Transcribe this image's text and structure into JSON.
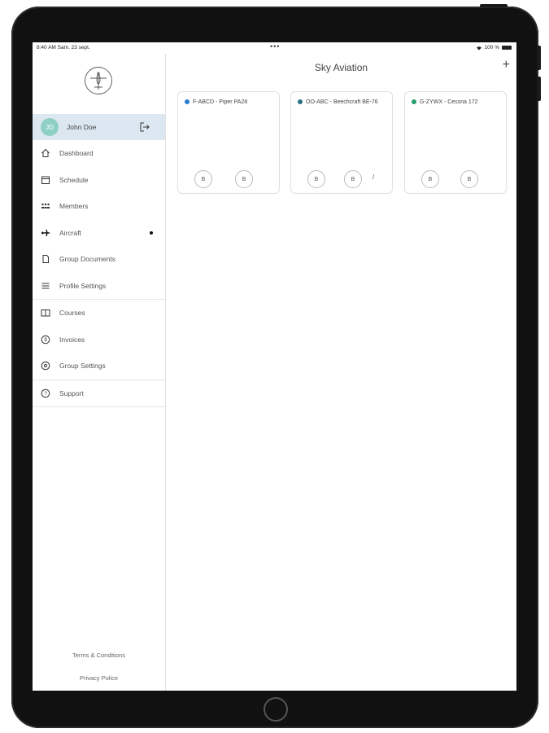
{
  "status_bar": {
    "time": "8:40 AM   Sam. 23 sept.",
    "dots": "•••",
    "battery": "100 %"
  },
  "app": {
    "title": "Sky Aviation",
    "add_label": "+"
  },
  "user": {
    "initials": "JD",
    "name": "John Doe"
  },
  "sidebar": {
    "items": [
      {
        "label": "Dashboard",
        "icon": "home-icon"
      },
      {
        "label": "Schedule",
        "icon": "calendar-icon"
      },
      {
        "label": "Members",
        "icon": "people-icon"
      },
      {
        "label": "Aircraft",
        "icon": "airplane-icon",
        "active_dot": true
      },
      {
        "label": "Group Documents",
        "icon": "document-icon"
      },
      {
        "label": "Profile Settings",
        "icon": "menu-lines-icon"
      },
      {
        "label": "Courses",
        "icon": "book-icon"
      },
      {
        "label": "Invoices",
        "icon": "dollar-icon"
      },
      {
        "label": "Group Settings",
        "icon": "gear-icon"
      },
      {
        "label": "Support",
        "icon": "question-icon"
      }
    ],
    "footer": {
      "terms": "Terms & Conditions",
      "privacy": "Privacy Police"
    }
  },
  "aircraft_cards": [
    {
      "title": "F-ABCD - Piper PA28",
      "color": "#2a7dd1",
      "btn1": "B",
      "btn2": "B",
      "extra": ""
    },
    {
      "title": "OO-ABC - Beechcraft BE-76",
      "color": "#2d6f86",
      "btn1": "B",
      "btn2": "B",
      "extra": "/"
    },
    {
      "title": "G-ZYWX - Cessna 172",
      "color": "#2a9d6f",
      "btn1": "B",
      "btn2": "B",
      "extra": ""
    }
  ]
}
